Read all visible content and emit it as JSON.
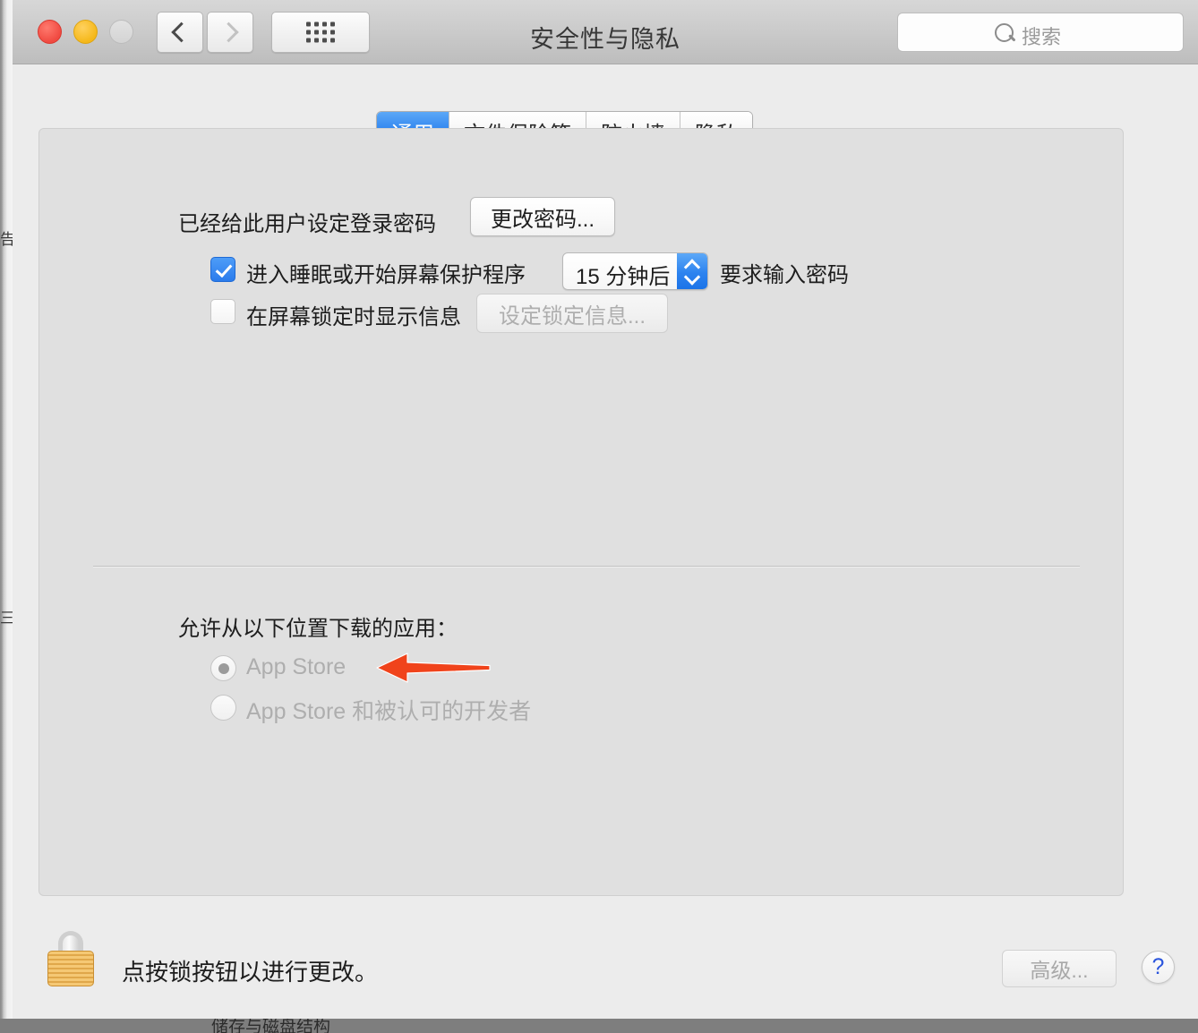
{
  "window": {
    "title": "安全性与隐私",
    "traffic_lights": {
      "close": "close-button",
      "minimize": "minimize-button",
      "zoom": "zoom-button"
    },
    "nav": {
      "back": "back-chevron-icon",
      "forward": "forward-chevron-icon",
      "show_all": "grid-icon"
    },
    "search": {
      "placeholder": "搜索",
      "value": ""
    }
  },
  "tabs": [
    {
      "label": "通用",
      "selected": true
    },
    {
      "label": "文件保险箱",
      "selected": false
    },
    {
      "label": "防火墙",
      "selected": false
    },
    {
      "label": "隐私",
      "selected": false
    }
  ],
  "general": {
    "password_status": "已经给此用户设定登录密码",
    "change_password_button": "更改密码...",
    "require_password": {
      "checked": true,
      "prefix_label": "进入睡眠或开始屏幕保护程序",
      "delay_value": "15 分钟后",
      "suffix_label": "要求输入密码"
    },
    "lock_message": {
      "checked": false,
      "label": "在屏幕锁定时显示信息",
      "button": "设定锁定信息...",
      "disabled": true
    },
    "downloads": {
      "heading": "允许从以下位置下载的应用：",
      "options": [
        {
          "label": "App Store",
          "selected": true,
          "disabled": true
        },
        {
          "label": "App Store 和被认可的开发者",
          "selected": false,
          "disabled": true
        }
      ]
    }
  },
  "footer": {
    "lock_icon": "closed-padlock-icon",
    "lock_text": "点按锁按钮以进行更改。",
    "advanced_button": "高级...",
    "help_button": "?"
  },
  "annotation": {
    "arrow_color": "#F0431B",
    "points_at": "App Store"
  },
  "background_window": {
    "left_fragments": [
      "告",
      "三"
    ],
    "bottom_fragment": "储存与磁盘结构"
  },
  "colors": {
    "accent_blue": "#2d83ef",
    "window_bg": "#ececec",
    "panel_bg": "#e0e0e0",
    "titlebar_top": "#d7d7d7",
    "lock_gold": "#e0a74a"
  }
}
